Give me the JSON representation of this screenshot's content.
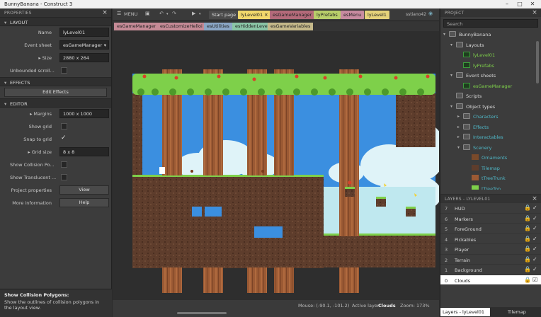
{
  "window": {
    "title": "BunnyBanana - Construct 3"
  },
  "properties": {
    "header": "PROPERTIES",
    "layout_section": "LAYOUT",
    "name_label": "Name",
    "name_value": "lyLevel01",
    "eventsheet_label": "Event sheet",
    "eventsheet_value": "esGameManager",
    "size_label": "Size",
    "size_value": "2880 x 264",
    "unbounded_label": "Unbounded scroll...",
    "effects_section": "EFFECTS",
    "edit_effects": "Edit Effects",
    "editor_section": "EDITOR",
    "margins_label": "Margins",
    "margins_value": "1000 x 1000",
    "showgrid_label": "Show grid",
    "snap_label": "Snap to grid",
    "gridsize_label": "Grid size",
    "gridsize_value": "8 x 8",
    "showcoll_label": "Show Collision Po...",
    "showtrans_label": "Show Translucent ...",
    "projprops_label": "Project properties",
    "projprops_btn": "View",
    "moreinfo_label": "More information",
    "moreinfo_btn": "Help",
    "help_title": "Show Collision Polygons:",
    "help_text": "Show the outlines of collision polygons in the layout view."
  },
  "toolbar": {
    "menu": "MENU",
    "tabs": [
      "Start page",
      "lyLevel01",
      "esGameManager",
      "lyPrefabs",
      "esMenu",
      "lyLevel1"
    ],
    "user": "sstiano42",
    "tabs2": [
      "esGameManager",
      "esCustomizeHelloi",
      "esUtilities",
      "esHiddenLevel",
      "esGameVariables"
    ]
  },
  "status": {
    "mouse": "Mouse: (-90.1, -101.2)",
    "active_layer_label": "Active layer:",
    "active_layer": "Clouds",
    "zoom": "Zoom: 173%"
  },
  "project": {
    "header": "PROJECT",
    "search_placeholder": "Search",
    "items": [
      "BunnyBanana",
      "Layouts",
      "lyLevel01",
      "lyPrefabs",
      "Event sheets",
      "esGameManager",
      "Scripts",
      "Object types",
      "Characters",
      "Effects",
      "Interactables",
      "Scenery",
      "Ornaments",
      "Tilemap",
      "tTreeTrunk",
      "tTreeTop"
    ]
  },
  "layers": {
    "header": "LAYERS - LYLEVEL01",
    "rows": [
      {
        "n": "7",
        "name": "HUD"
      },
      {
        "n": "6",
        "name": "Markers"
      },
      {
        "n": "5",
        "name": "ForeGround"
      },
      {
        "n": "4",
        "name": "Pickables"
      },
      {
        "n": "3",
        "name": "Player"
      },
      {
        "n": "2",
        "name": "Terrain"
      },
      {
        "n": "1",
        "name": "Background"
      },
      {
        "n": "0",
        "name": "Clouds"
      }
    ],
    "tab_layers": "Layers - lyLevel01",
    "tab_tilemap": "Tilemap"
  },
  "colors": {
    "accent": "#f1d86b",
    "sky": "#3a8ee0",
    "grass": "#7ed04a",
    "dirt": "#5a3a2a"
  }
}
